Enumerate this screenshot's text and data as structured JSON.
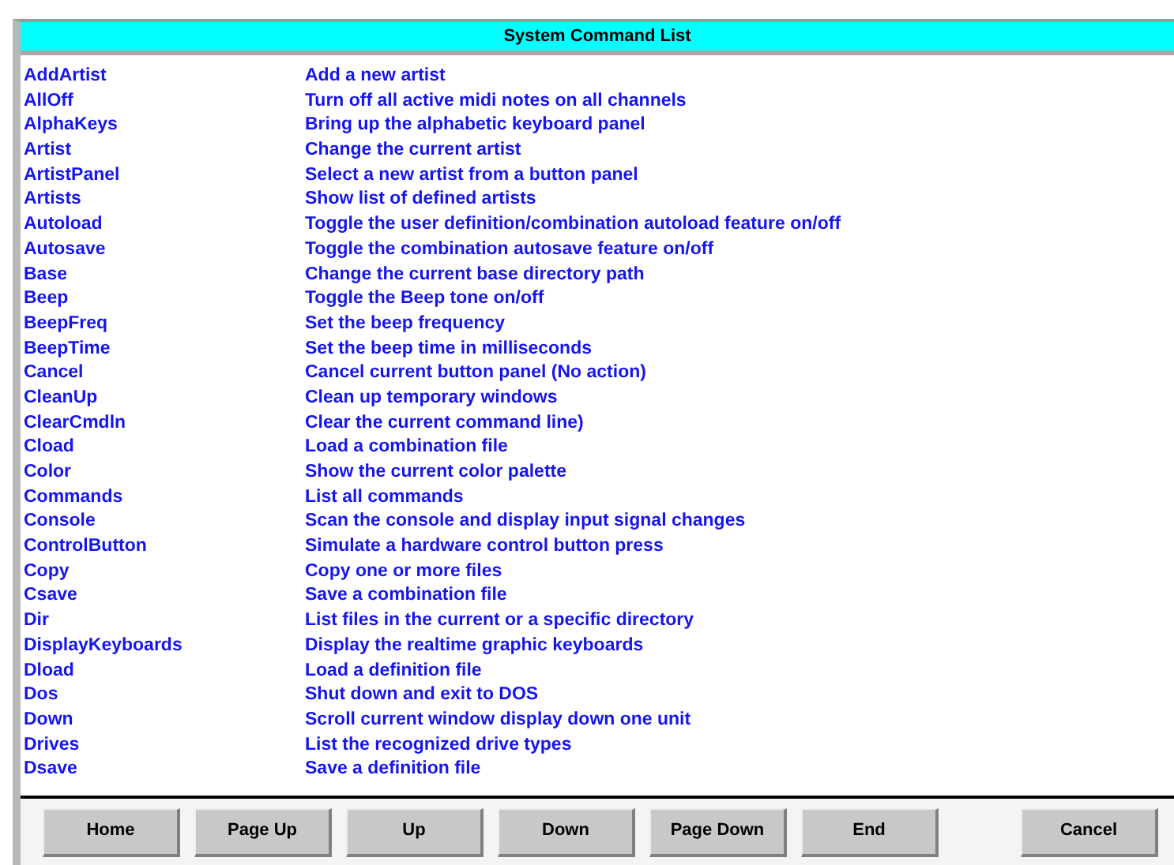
{
  "window": {
    "title": "System Command List"
  },
  "commands": [
    {
      "name": "AddArtist",
      "description": "Add a new artist"
    },
    {
      "name": "AllOff",
      "description": "Turn off all active midi notes on all channels"
    },
    {
      "name": "AlphaKeys",
      "description": "Bring up the alphabetic keyboard panel"
    },
    {
      "name": "Artist",
      "description": "Change the current artist"
    },
    {
      "name": "ArtistPanel",
      "description": "Select a new artist from a button panel"
    },
    {
      "name": "Artists",
      "description": "Show list of defined artists"
    },
    {
      "name": "Autoload",
      "description": "Toggle the user definition/combination autoload feature on/off"
    },
    {
      "name": "Autosave",
      "description": "Toggle the combination autosave feature on/off"
    },
    {
      "name": "Base",
      "description": "Change the current base directory path"
    },
    {
      "name": "Beep",
      "description": "Toggle the Beep tone on/off"
    },
    {
      "name": "BeepFreq",
      "description": "Set the beep frequency"
    },
    {
      "name": "BeepTime",
      "description": "Set the beep time in milliseconds"
    },
    {
      "name": "Cancel",
      "description": "Cancel current button panel (No action)"
    },
    {
      "name": "CleanUp",
      "description": "Clean up temporary windows"
    },
    {
      "name": "ClearCmdln",
      "description": "Clear the current command line)"
    },
    {
      "name": "Cload",
      "description": "Load a combination file"
    },
    {
      "name": "Color",
      "description": "Show the current color palette"
    },
    {
      "name": "Commands",
      "description": "List all commands"
    },
    {
      "name": "Console",
      "description": "Scan the console and display input signal changes"
    },
    {
      "name": "ControlButton",
      "description": "Simulate a hardware control button press"
    },
    {
      "name": "Copy",
      "description": "Copy one or more files"
    },
    {
      "name": "Csave",
      "description": "Save a combination file"
    },
    {
      "name": "Dir",
      "description": "List files in the current or a specific directory"
    },
    {
      "name": "DisplayKeyboards",
      "description": "Display the realtime graphic keyboards"
    },
    {
      "name": "Dload",
      "description": "Load a definition file"
    },
    {
      "name": "Dos",
      "description": "Shut down and exit to DOS"
    },
    {
      "name": "Down",
      "description": "Scroll current window display down one unit"
    },
    {
      "name": "Drives",
      "description": "List the recognized drive types"
    },
    {
      "name": "Dsave",
      "description": "Save a definition file"
    }
  ],
  "nav_buttons": [
    "Home",
    "Page Up",
    "Up",
    "Down",
    "Page Down",
    "End"
  ],
  "cancel_button": "Cancel"
}
